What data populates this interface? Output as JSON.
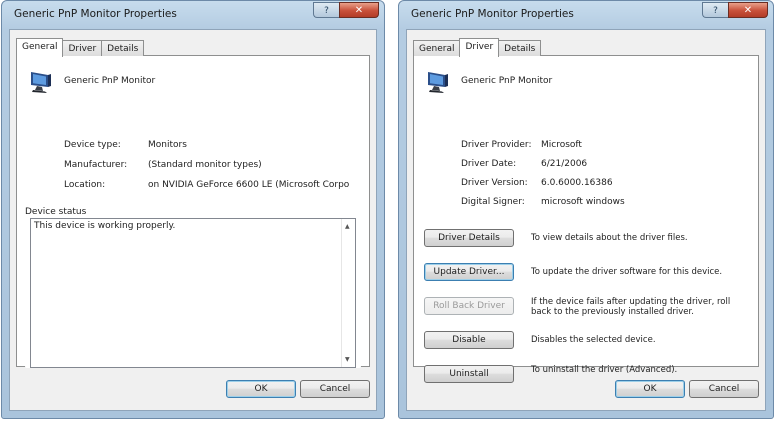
{
  "window_general": {
    "title": "Generic PnP Monitor Properties",
    "tabs": [
      {
        "label": "General",
        "active": true
      },
      {
        "label": "Driver",
        "active": false
      },
      {
        "label": "Details",
        "active": false
      }
    ],
    "device_name": "Generic PnP Monitor",
    "properties": [
      {
        "label": "Device type:",
        "value": "Monitors"
      },
      {
        "label": "Manufacturer:",
        "value": "(Standard monitor types)"
      },
      {
        "label": "Location:",
        "value": "on NVIDIA GeForce 6600 LE (Microsoft Corpo"
      }
    ],
    "status_group_label": "Device status",
    "status_text": "This device is working properly.",
    "ok_label": "OK",
    "cancel_label": "Cancel"
  },
  "window_driver": {
    "title": "Generic PnP Monitor Properties",
    "tabs": [
      {
        "label": "General",
        "active": false
      },
      {
        "label": "Driver",
        "active": true
      },
      {
        "label": "Details",
        "active": false
      }
    ],
    "device_name": "Generic PnP Monitor",
    "properties": [
      {
        "label": "Driver Provider:",
        "value": "Microsoft"
      },
      {
        "label": "Driver Date:",
        "value": "6/21/2006"
      },
      {
        "label": "Driver Version:",
        "value": "6.0.6000.16386"
      },
      {
        "label": "Digital Signer:",
        "value": "microsoft windows"
      }
    ],
    "actions": [
      {
        "button": "Driver Details",
        "description": "To view details about the driver files.",
        "enabled": true
      },
      {
        "button": "Update Driver...",
        "description": "To update the driver software for this device.",
        "enabled": true
      },
      {
        "button": "Roll Back Driver",
        "description": "If the device fails after updating the driver, roll back to the previously installed driver.",
        "enabled": false
      },
      {
        "button": "Disable",
        "description": "Disables the selected device.",
        "enabled": true
      },
      {
        "button": "Uninstall",
        "description": "To uninstall the driver (Advanced).",
        "enabled": true
      }
    ],
    "ok_label": "OK",
    "cancel_label": "Cancel"
  },
  "icons": {
    "monitor": "monitor-icon",
    "help": "help-icon",
    "close": "close-icon"
  },
  "colors": {
    "title_glass": "#b4cce2",
    "close_button": "#c8503a",
    "dialog_face": "#f0f0f0",
    "default_button_border": "#3c7fb1"
  }
}
